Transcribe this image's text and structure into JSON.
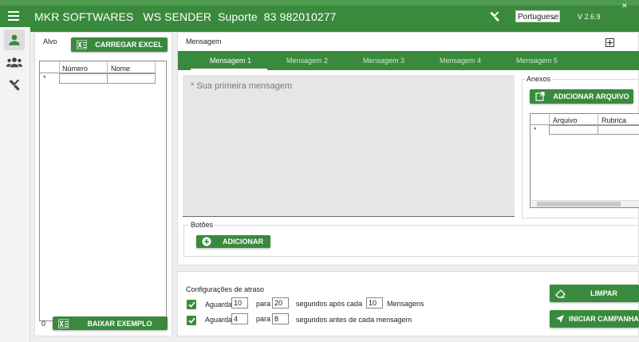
{
  "header": {
    "title": "MKR SOFTWARES   WS SENDER  Suporte  83 982010277",
    "language": "Portuguese",
    "version": "V 2.6.9"
  },
  "nav": {
    "items": [
      {
        "icon": "user-icon",
        "active": true
      },
      {
        "icon": "group-icon",
        "active": false
      },
      {
        "icon": "tools-icon",
        "active": false
      }
    ]
  },
  "left": {
    "alvo_label": "Alvo",
    "load_excel_label": "CARREGAR EXCEL",
    "grid_headers": [
      "Número",
      "Nome"
    ],
    "new_row_marker": "*",
    "count": "0",
    "download_example_label": "BAIXAR EXEMPLO"
  },
  "message": {
    "section_label": "Mensagem",
    "tabs": [
      "Mensagem 1",
      "Mensagem 2",
      "Mensagem 3",
      "Mensagem 4",
      "Mensagem 5"
    ],
    "active_tab": 0,
    "placeholder": "* Sua primeira mensagem",
    "buttons_label": "Botões",
    "add_button_label": "ADICIONAR"
  },
  "attachments": {
    "label": "Anexos",
    "add_file_label": "ADICIONAR ARQUIVO",
    "grid_headers": [
      "Arquivo",
      "Rubrica"
    ],
    "new_row_marker": "*"
  },
  "delay": {
    "title": "Configurações de atraso",
    "row1": {
      "wait": "Aguarda",
      "value1": "10",
      "to": "para",
      "value2": "20",
      "suffix": "segundos após cada",
      "value3": "10",
      "suffix2": "Mensagens"
    },
    "row2": {
      "wait": "Aguarda",
      "value1": "4",
      "to": "para",
      "value2": "8",
      "suffix": "segundos antes de cada mensagem"
    }
  },
  "actions": {
    "clear_label": "LIMPAR",
    "start_label": "INICIAR CAMPANHA"
  },
  "colors": {
    "primary_green": "#3a8a3e",
    "background": "#eeeeee"
  }
}
